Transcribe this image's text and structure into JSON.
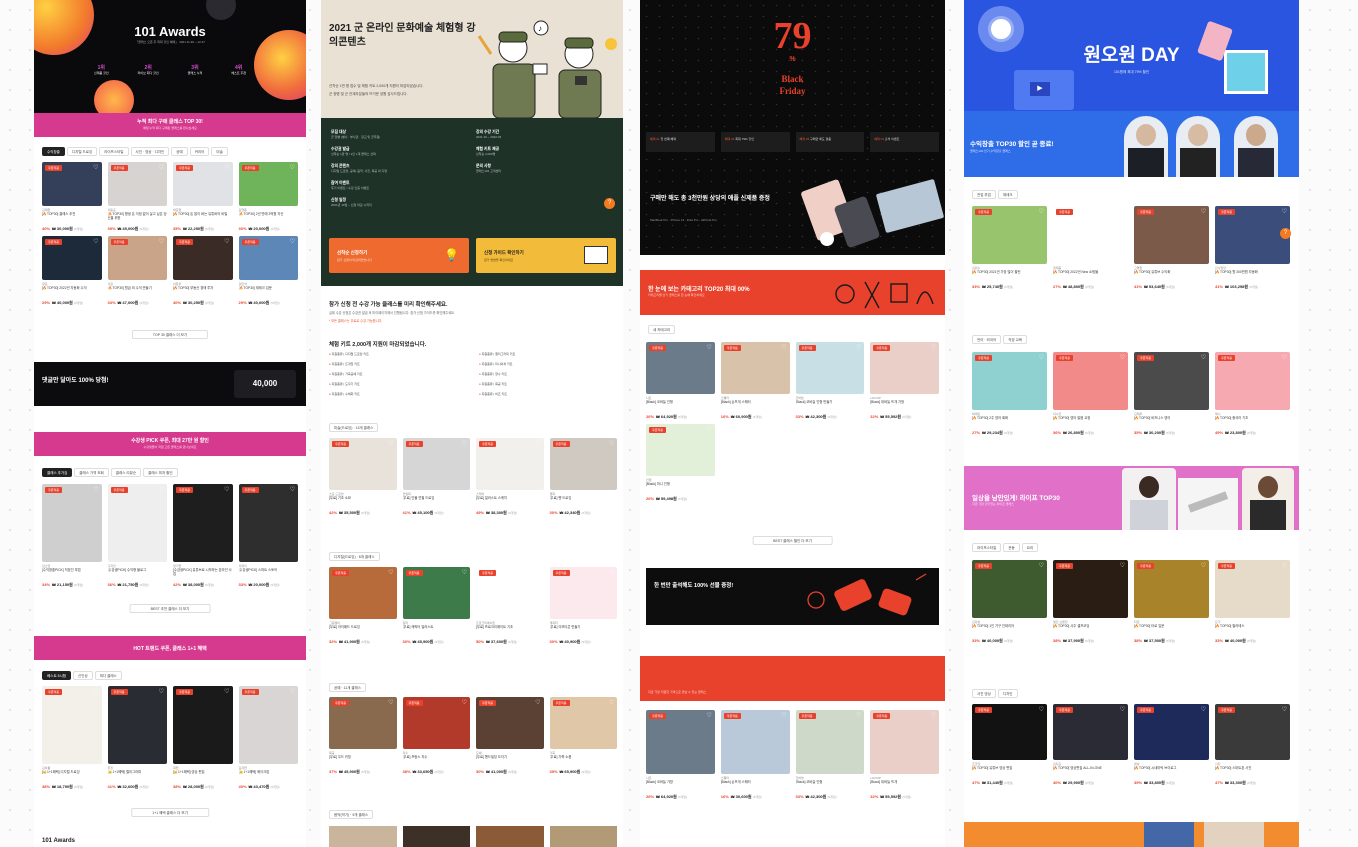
{
  "col1": {
    "hero_title": "101 Awards",
    "hero_sub": "「클래스 오픈 후 최대 할인 혜택」 2021.11.30 ~ 12.27",
    "hero_stats": [
      {
        "n": "1위",
        "l": "신제품 할인"
      },
      {
        "n": "2위",
        "l": "라이브 최다 할인"
      },
      {
        "n": "3위",
        "l": "클래스 누적"
      },
      {
        "n": "4위",
        "l": "베스트 추천"
      }
    ],
    "banner1": "누적 최다 구매 클래스 TOP 30!",
    "banner1_sub": "매일 누적 최다 구매된 클래스를 만나보세요",
    "tabs": [
      "수익창출",
      "디지털 드로잉",
      "라이프스타일",
      "사진 · 영상 · 디자인",
      "공예",
      "커리어",
      "미술"
    ],
    "cards_a": [
      {
        "auth": "김재완",
        "name": "[🔥TOP30] 클래스 추천",
        "price": "₩ 30,000원",
        "disc": "40%",
        "bg": "#34405a"
      },
      {
        "auth": "이동훈",
        "name": "[🔥TOP30] 평생 돈 걱정 없이 살고 싶은 당신을 위한",
        "price": "₩ 45,000원",
        "disc": "39%",
        "bg": "#d7d3d0"
      },
      {
        "auth": "박준형",
        "name": "[🔥TOP30] 돈 많이 버는 유튜버의 비밀",
        "price": "₩ 22,250원",
        "disc": "35%",
        "bg": "#e0e2e6"
      },
      {
        "auth": "김현종",
        "name": "[🔥TOP30] 2년 만에 3억원 자산",
        "price": "₩ 20,000원",
        "disc": "30%",
        "bg": "#6fb35a"
      },
      {
        "auth": "정준",
        "name": "[🔥TOP30] 2022년 자동화 수익",
        "price": "₩ 40,000원",
        "disc": "29%",
        "bg": "#1d2a3a"
      },
      {
        "auth": "이윤",
        "name": "[🔥TOP30] 월급 외 수익 만들기",
        "price": "₩ 47,000원",
        "disc": "33%",
        "bg": "#caa488"
      },
      {
        "auth": "이창우",
        "name": "[🔥TOP30] 부동산 경매 투자",
        "price": "₩ 30,250원",
        "disc": "40%",
        "bg": "#3a2b26"
      },
      {
        "auth": "강민석",
        "name": "[🔥TOP30] 재테크 입문",
        "price": "₩ 40,000원",
        "disc": "29%",
        "bg": "#5c87b6"
      }
    ],
    "more_a": "TOP 30 클래스 더 보기",
    "prize_text": "댓글만 달아도 100% 당첨!",
    "prize_amount": "40,000",
    "banner2": "수강생 PICK 쿠폰, 최대 27만 원 할인",
    "banner2_sub": "수강생들이 직접 고른 클래스를 만나보세요",
    "tabs2": [
      "클래스 추가검",
      "클래스 가격 조회",
      "클래스 리뷰순",
      "클래스 최저 할인"
    ],
    "cards_b": [
      {
        "auth": "김소연",
        "name": "[수익창출PICK] 직장인 부업",
        "price": "₩ 21,150원",
        "disc": "34%",
        "bg": "#cfcfcf"
      },
      {
        "auth": "디자인",
        "name": "[수강생PICK] 수익형 블로그",
        "price": "₩ 21,750원",
        "disc": "36%",
        "bg": "#eeeeee"
      },
      {
        "auth": "정기엽",
        "name": "[수강생PICK] 유튜브로 시작하는 온라인 사업",
        "price": "₩ 38,000원",
        "disc": "42%",
        "bg": "#1e1e1e"
      },
      {
        "auth": "이대식",
        "name": "[수강생PICK] 스마트 스토어",
        "price": "₩ 20,000원",
        "disc": "33%",
        "bg": "#2e2e2e"
      }
    ],
    "more_b": "BEST 추천 클래스 더 보기",
    "banner3": "HOT 트렌드 쿠폰, 클래스 1+1 혜택",
    "tabs3": [
      "베스트 5시험",
      "신인상",
      "최다 클래스"
    ],
    "cards_c": [
      {
        "auth": "김아름",
        "name": "[👑1+1혜택] 디지털 드로잉",
        "price": "₩ 18,790원",
        "disc": "38%",
        "bg": "#f3f0ea"
      },
      {
        "auth": "무진",
        "name": "[👑1+1혜택] 캘리그라피",
        "price": "₩ 32,600원",
        "disc": "41%",
        "bg": "#2a2c33"
      },
      {
        "auth": "최현",
        "name": "[👑1+1혜택] 영상 편집",
        "price": "₩ 28,000원",
        "disc": "38%",
        "bg": "#1a1a1a"
      },
      {
        "auth": "김지현",
        "name": "[👑1+1혜택] 메이크업",
        "price": "₩ 43,470원",
        "disc": "40%",
        "bg": "#d9d5d4"
      }
    ],
    "more_c": "1+1 혜택 클래스 더 보기",
    "footer_title": "101 Awards"
  },
  "col2": {
    "hero_title": "2021 군 온라인 문화예술 체험형 강의콘텐츠",
    "hero_desc": "선착순 1만 명 접수 및 체험 키트 2,000개 지원이 마감되었습니다.",
    "hero_desc2": "군 장병 및 군 관계자분들의 뜨거운 성원 감사드립니다.",
    "info": [
      {
        "k": "모집 대상",
        "v": "군 장병 (병사 · 부사관 · 장교 및 군무원)"
      },
      {
        "k": "수강권 발급",
        "v": "선착순 1만 명 / 1인 1개 클래스 선택"
      },
      {
        "k": "강의 콘텐츠",
        "v": "디지털 드로잉, 공예, 음악, 사진, 목공 외 다양"
      },
      {
        "k": "참여 이벤트",
        "v": "후기 이벤트 / 수강 인증 이벤트"
      },
      {
        "k": "신청 일정",
        "v": "2021년 10월 ~ 신청 마감 시까지"
      }
    ],
    "info2": [
      {
        "k": "강의 수강 기간",
        "v": "2021.10 ~ 2022.03"
      },
      {
        "k": "체험 키트 제공",
        "v": "선착순 2,000명"
      },
      {
        "k": "문의 사항",
        "v": "클래스101 고객센터"
      }
    ],
    "btn_apply": "선착순 신청하기",
    "btn_apply_sub": "참가 신청이 마감되었습니다",
    "btn_guide": "신청 가이드 확인하기",
    "btn_guide_sub": "참가 방법을 확인하세요",
    "notice_title": "참가 신청 전 수강 가능 클래스를 미리 확인해주세요.",
    "notice_sub": "실제 수강 신청은 수강권 발급 후 마이페이지에서 진행됩니다. 참가 신청 가이드를 확인해주세요.",
    "notice_red": "* 모든 클래스는 무료로 수강 가능합니다.",
    "kit_title": "체험 키트 2,000개 지원이 마감되었습니다.",
    "kit_rows": [
      "지원종류 | 디지털 드로잉 키트",
      "지원종류 | 캘리그라피 키트",
      "지원종류 | 뜨개질 키트",
      "지원종류 | 미니어처 키트",
      "지원종류 | 가죽공예 키트",
      "지원종류 | 향수 키트",
      "지원종류 | 도자기 키트",
      "지원종류 | 목공 키트",
      "지원종류 | 수채화 키트",
      "지원종류 | 비즈 키트"
    ],
    "section1": "미술(드로잉) · 13개 클래스",
    "cards1": [
      {
        "auth": "소묘 드로잉",
        "name": "[무료] 기초 소묘",
        "price": "₩ 35,500원",
        "disc": "42%",
        "bg": "#e8e2da"
      },
      {
        "auth": "연필화",
        "name": "[무료] 인물 연필 드로잉",
        "price": "₩ 45,100원",
        "disc": "41%",
        "bg": "#d6d6d6"
      },
      {
        "auth": "스케치",
        "name": "[무료] 일러스트 스케치",
        "price": "₩ 38,300원",
        "disc": "49%",
        "bg": "#f2f0ec"
      },
      {
        "auth": "펜화",
        "name": "[무료] 펜 드로잉",
        "price": "₩ 42,340원",
        "disc": "30%",
        "bg": "#cfc9c1"
      }
    ],
    "section2": "디지털(드로잉) · 8개 클래스",
    "cards2": [
      {
        "auth": "그림쟁이",
        "name": "[무료] 아이패드 드로잉",
        "price": "₩ 41,900원",
        "disc": "32%",
        "bg": "#b86b3a"
      },
      {
        "auth": "일러",
        "name": "[무료] 캐릭터 일러스트",
        "price": "₩ 45,900원",
        "disc": "30%",
        "bg": "#3e7b4a"
      },
      {
        "auth": "프로크리에이트",
        "name": "[무료] 프로크리에이트 기초",
        "price": "₩ 37,600원",
        "disc": "50%",
        "bg": "#ffffff"
      },
      {
        "auth": "캐릭터",
        "name": "[무료] 이모티콘 만들기",
        "price": "₩ 40,900원",
        "disc": "30%",
        "bg": "#fbe9ee"
      }
    ],
    "section3": "공예 · 11개 클래스",
    "cards3": [
      {
        "auth": "목공",
        "name": "[무료] 우드 카빙",
        "price": "₩ 45,900원",
        "disc": "37%",
        "bg": "#8a6a4e"
      },
      {
        "auth": "자수",
        "name": "[무료] 프랑스 자수",
        "price": "₩ 33,650원",
        "disc": "38%",
        "bg": "#b23a2a"
      },
      {
        "auth": "도예",
        "name": "[무료] 핸드빌딩 도자기",
        "price": "₩ 41,000원",
        "disc": "30%",
        "bg": "#5a4134"
      },
      {
        "auth": "가죽",
        "name": "[무료] 가죽 소품",
        "price": "₩ 65,900원",
        "disc": "39%",
        "bg": "#e0c7a8"
      }
    ],
    "section4": "음악(악기) · 9개 클래스"
  },
  "col3": {
    "hero_num": "79",
    "hero_pct": "%",
    "hero_title1": "Black",
    "hero_title2": "Friday",
    "benefits": [
      {
        "tag": "혜택 01",
        "t": "첫 번째 혜택"
      },
      {
        "tag": "혜택 02",
        "t": "최대 79% 할인"
      },
      {
        "tag": "혜택 03",
        "t": "구매만 해도 경품"
      },
      {
        "tag": "혜택 04",
        "t": "출석 이벤트"
      }
    ],
    "gift_title": "구매만 해도 총 3천만원 상당의 애플 신제품 증정",
    "gift_sub": "MacBook Pro · iPhone 13 · iPad Pro · AirPods Pro",
    "cat_banner": "한 눈에 보는 카테고리 TOP20 최대 00%",
    "cat_sub": "카테고리별 인기 클래스를 한 눈에 확인하세요",
    "tab": "새 카테고리",
    "cards_a": [
      {
        "auth": "니트",
        "name": "[Black] 코바늘 인형",
        "price": "₩ 64,920원",
        "disc": "26%",
        "bg": "#6b7b8a"
      },
      {
        "auth": "스웨터",
        "name": "[Black] 손뜨개 스웨터",
        "price": "₩ 60,900원",
        "disc": "16%",
        "bg": "#d8c2a9"
      },
      {
        "auth": "코바늘",
        "name": "[Black] 코바늘 인형 만들기",
        "price": "₩ 42,300원",
        "disc": "33%",
        "bg": "#c9dfe6"
      },
      {
        "auth": "LOOOP",
        "name": "[Black] 대바늘 뜨개 가방",
        "price": "₩ 55,592원",
        "disc": "32%",
        "bg": "#e9cfc8"
      },
      {
        "auth": "인형",
        "name": "[Black] 미니 인형",
        "price": "₩ 59,498원",
        "disc": "26%",
        "bg": "#e2efd9"
      }
    ],
    "more": "BEST 클래스 할인 더 보기",
    "attend_title": "한 번만 출석해도 100% 선물 증정!",
    "red_sub": "지금 가장 저렴한 가격으로 만날 수 있는 클래스",
    "cards_b": [
      {
        "auth": "니트",
        "name": "[Black] 코바늘 가방",
        "price": "₩ 64,920원",
        "disc": "26%",
        "bg": "#6b7b8a"
      },
      {
        "auth": "스웨터",
        "name": "[Black] 손뜨개 스웨터",
        "price": "₩ 30,600원",
        "disc": "16%",
        "bg": "#b9c9da"
      },
      {
        "auth": "코바늘",
        "name": "[Black] 코바늘 인형",
        "price": "₩ 42,300원",
        "disc": "33%",
        "bg": "#cfd9c9"
      },
      {
        "auth": "LOOOP",
        "name": "[Black] 대바늘 뜨개",
        "price": "₩ 55,592원",
        "disc": "32%",
        "bg": "#e9cfc8"
      }
    ]
  },
  "col4": {
    "hero_title": "원오원 DAY",
    "hero_sub": "101원에 최대 79% 할인",
    "banner": "수익창출 TOP30 할인 곧 종료!",
    "banner_sub": "클래스101 인기 수익창출 클래스",
    "tabs": [
      "전업 부업",
      "재테크"
    ],
    "cards_a": [
      {
        "auth": "김민수",
        "name": "[🔥TOP30] 2021년 가장 많이 팔린",
        "price": "₩ 25,740원",
        "disc": "33%",
        "bg": "#98c46e"
      },
      {
        "auth": "정재웅",
        "name": "[🔥TOP30] 2022년 New 쇼핑몰",
        "price": "₩ 48,800원",
        "disc": "27%",
        "bg": "#ffffff"
      },
      {
        "auth": "고명환",
        "name": "[🔥TOP30] 유튜브 수익화",
        "price": "₩ 53,640원",
        "disc": "41%",
        "bg": "#7b5a4a"
      },
      {
        "auth": "신사임당",
        "name": "[🔥TOP30] 월 300만원 자동화",
        "price": "₩ 103,298원",
        "disc": "41%",
        "bg": "#3b4d7a"
      }
    ],
    "tabs2": [
      "언어 · 외국어",
      "직장 교육"
    ],
    "cards_b": [
      {
        "auth": "박세린",
        "name": "[🔥TOP30] 2주 영어 회화",
        "price": "₩ 29,234원",
        "disc": "27%",
        "bg": "#8fd0d0"
      },
      {
        "auth": "이수진",
        "name": "[🔥TOP30] 영어 발음 교정",
        "price": "₩ 26,800원",
        "disc": "36%",
        "bg": "#f28a8a"
      },
      {
        "auth": "김재우",
        "name": "[🔥TOP30] 비즈니스 영어",
        "price": "₩ 30,200원",
        "disc": "35%",
        "bg": "#4b4b4b"
      },
      {
        "auth": "제니",
        "name": "[🔥TOP30] 중국어 기초",
        "price": "₩ 23,800원",
        "disc": "49%",
        "bg": "#f6a9b0"
      }
    ],
    "banner2": "일상을 낭만있게! 라이프 TOP30",
    "banner2_sub": "지금 가장 인기있는 라이프 클래스",
    "tabs3": [
      "라이프스타일",
      "운동",
      "요리"
    ],
    "cards_c": [
      {
        "auth": "김강호",
        "name": "[🔥TOP30] 1인 가구 인테리어",
        "price": "₩ 40,000원",
        "disc": "33%",
        "bg": "#3d5b2f"
      },
      {
        "auth": "셀프 브랜딩",
        "name": "[🔥TOP30] 사주 셀프코딩",
        "price": "₩ 37,900원",
        "disc": "38%",
        "bg": "#2a1d14"
      },
      {
        "auth": "타로",
        "name": "[🔥TOP30] 타로 입문",
        "price": "₩ 37,500원",
        "disc": "38%",
        "bg": "#a8832a"
      },
      {
        "auth": "요가",
        "name": "[🔥TOP30] 필라테스",
        "price": "₩ 40,000원",
        "disc": "33%",
        "bg": "#e6dac9"
      }
    ],
    "tabs4": [
      "사진 영상",
      "디자인"
    ],
    "cards_d": [
      {
        "auth": "조코딩",
        "name": "[🔥TOP30] 유튜브 영상 편집",
        "price": "₩ 31,440원",
        "disc": "47%",
        "bg": "#121212"
      },
      {
        "auth": "김지훈",
        "name": "[🔥TOP30] 영상편집 ALL-IN-ONE",
        "price": "₩ 29,900원",
        "disc": "40%",
        "bg": "#2b2b35"
      },
      {
        "auth": "영상",
        "name": "[🔥TOP30] 시네마틱 브이로그",
        "price": "₩ 33,800원",
        "disc": "39%",
        "bg": "#1d2a5a"
      },
      {
        "auth": "사진",
        "name": "[🔥TOP30] 스마트폰 사진",
        "price": "₩ 33,300원",
        "disc": "47%",
        "bg": "#3a3a3a"
      }
    ]
  }
}
